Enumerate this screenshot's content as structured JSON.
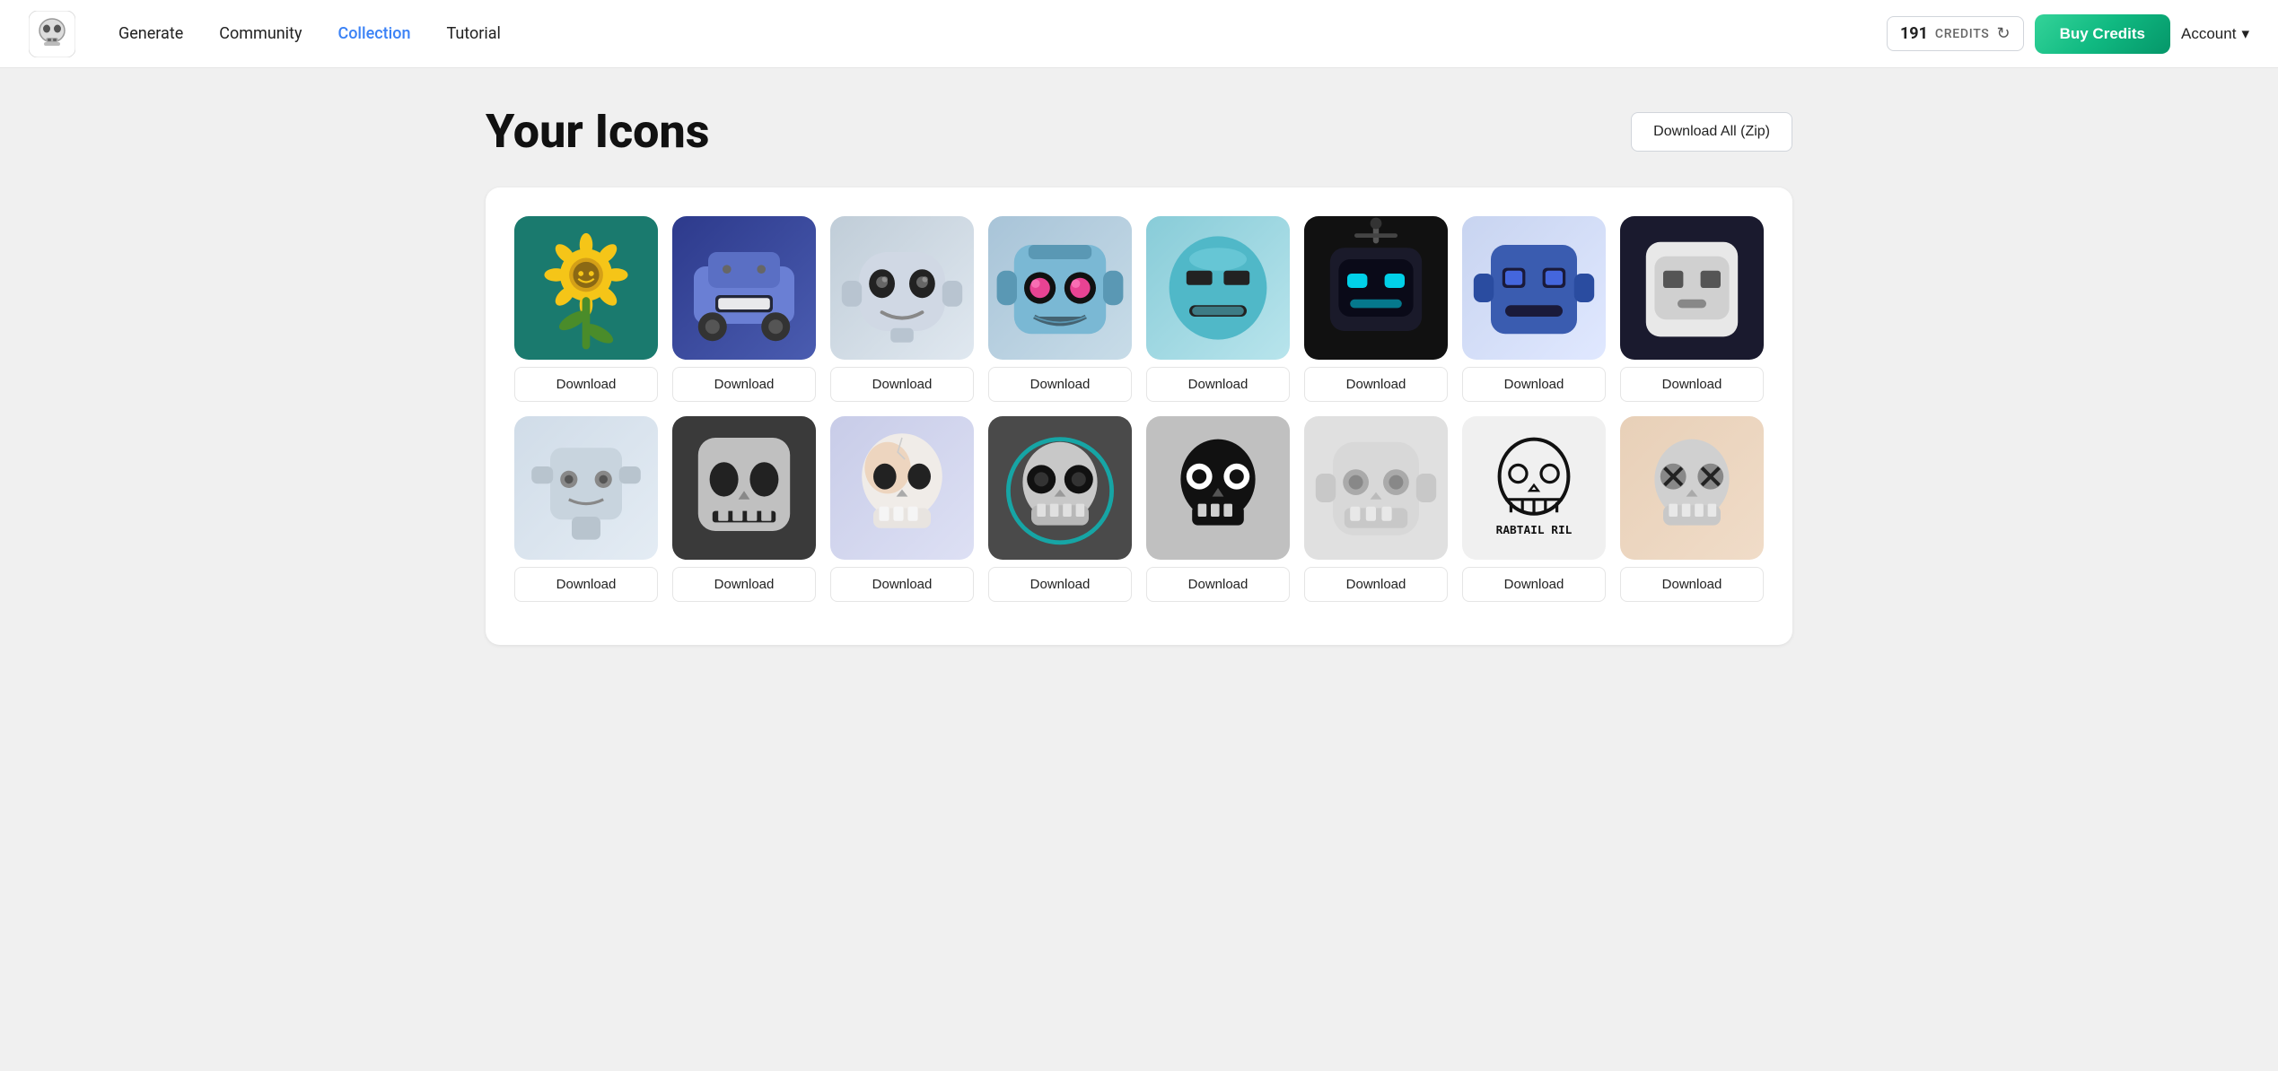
{
  "nav": {
    "links": [
      {
        "label": "Generate",
        "active": false
      },
      {
        "label": "Community",
        "active": false
      },
      {
        "label": "Collection",
        "active": true
      },
      {
        "label": "Tutorial",
        "active": false
      }
    ],
    "credits": {
      "count": "191",
      "label": "CREDITS"
    },
    "buy_label": "Buy Credits",
    "account_label": "Account"
  },
  "page": {
    "title": "Your Icons",
    "download_all_label": "Download All (Zip)"
  },
  "icons_row1": [
    {
      "id": "sunflower",
      "bg": "#1a7a6e",
      "type": "sunflower",
      "label": "Download"
    },
    {
      "id": "car-robot",
      "bg": "#2d3a8c",
      "type": "car-robot",
      "label": "Download"
    },
    {
      "id": "round-robot",
      "bg": "#c8d4e0",
      "type": "round-robot",
      "label": "Download"
    },
    {
      "id": "pink-eyes-robot",
      "bg": "#b8cfe0",
      "type": "pink-eyes-robot",
      "label": "Download"
    },
    {
      "id": "teal-robot",
      "bg": "#a8d8e0",
      "type": "teal-robot",
      "label": "Download"
    },
    {
      "id": "dark-robot",
      "bg": "#1a1a2e",
      "type": "dark-robot",
      "label": "Download"
    },
    {
      "id": "blue-robot",
      "bg": "#d0d8f0",
      "type": "blue-robot",
      "label": "Download"
    },
    {
      "id": "white-robot-dark",
      "bg": "#1a1a2e",
      "type": "white-robot-dark",
      "label": "Download"
    }
  ],
  "icons_row2": [
    {
      "id": "small-robot",
      "bg": "#dce4f0",
      "type": "small-robot",
      "label": "Download"
    },
    {
      "id": "dark-skull-cube",
      "bg": "#3a3a3a",
      "type": "dark-skull-cube",
      "label": "Download"
    },
    {
      "id": "lit-skull",
      "bg": "#dce0f0",
      "type": "lit-skull",
      "label": "Download"
    },
    {
      "id": "dark-skull-round",
      "bg": "#4a4a4a",
      "type": "dark-skull-round",
      "label": "Download"
    },
    {
      "id": "black-skull",
      "bg": "#c8c8c8",
      "type": "black-skull",
      "label": "Download"
    },
    {
      "id": "grey-robot-skull",
      "bg": "#e0e0e0",
      "type": "grey-robot-skull",
      "label": "Download"
    },
    {
      "id": "text-skull",
      "bg": "#f0f0f0",
      "type": "text-skull",
      "label": "Download"
    },
    {
      "id": "cross-skull",
      "bg": "#e8d8c8",
      "type": "cross-skull",
      "label": "Download"
    }
  ]
}
